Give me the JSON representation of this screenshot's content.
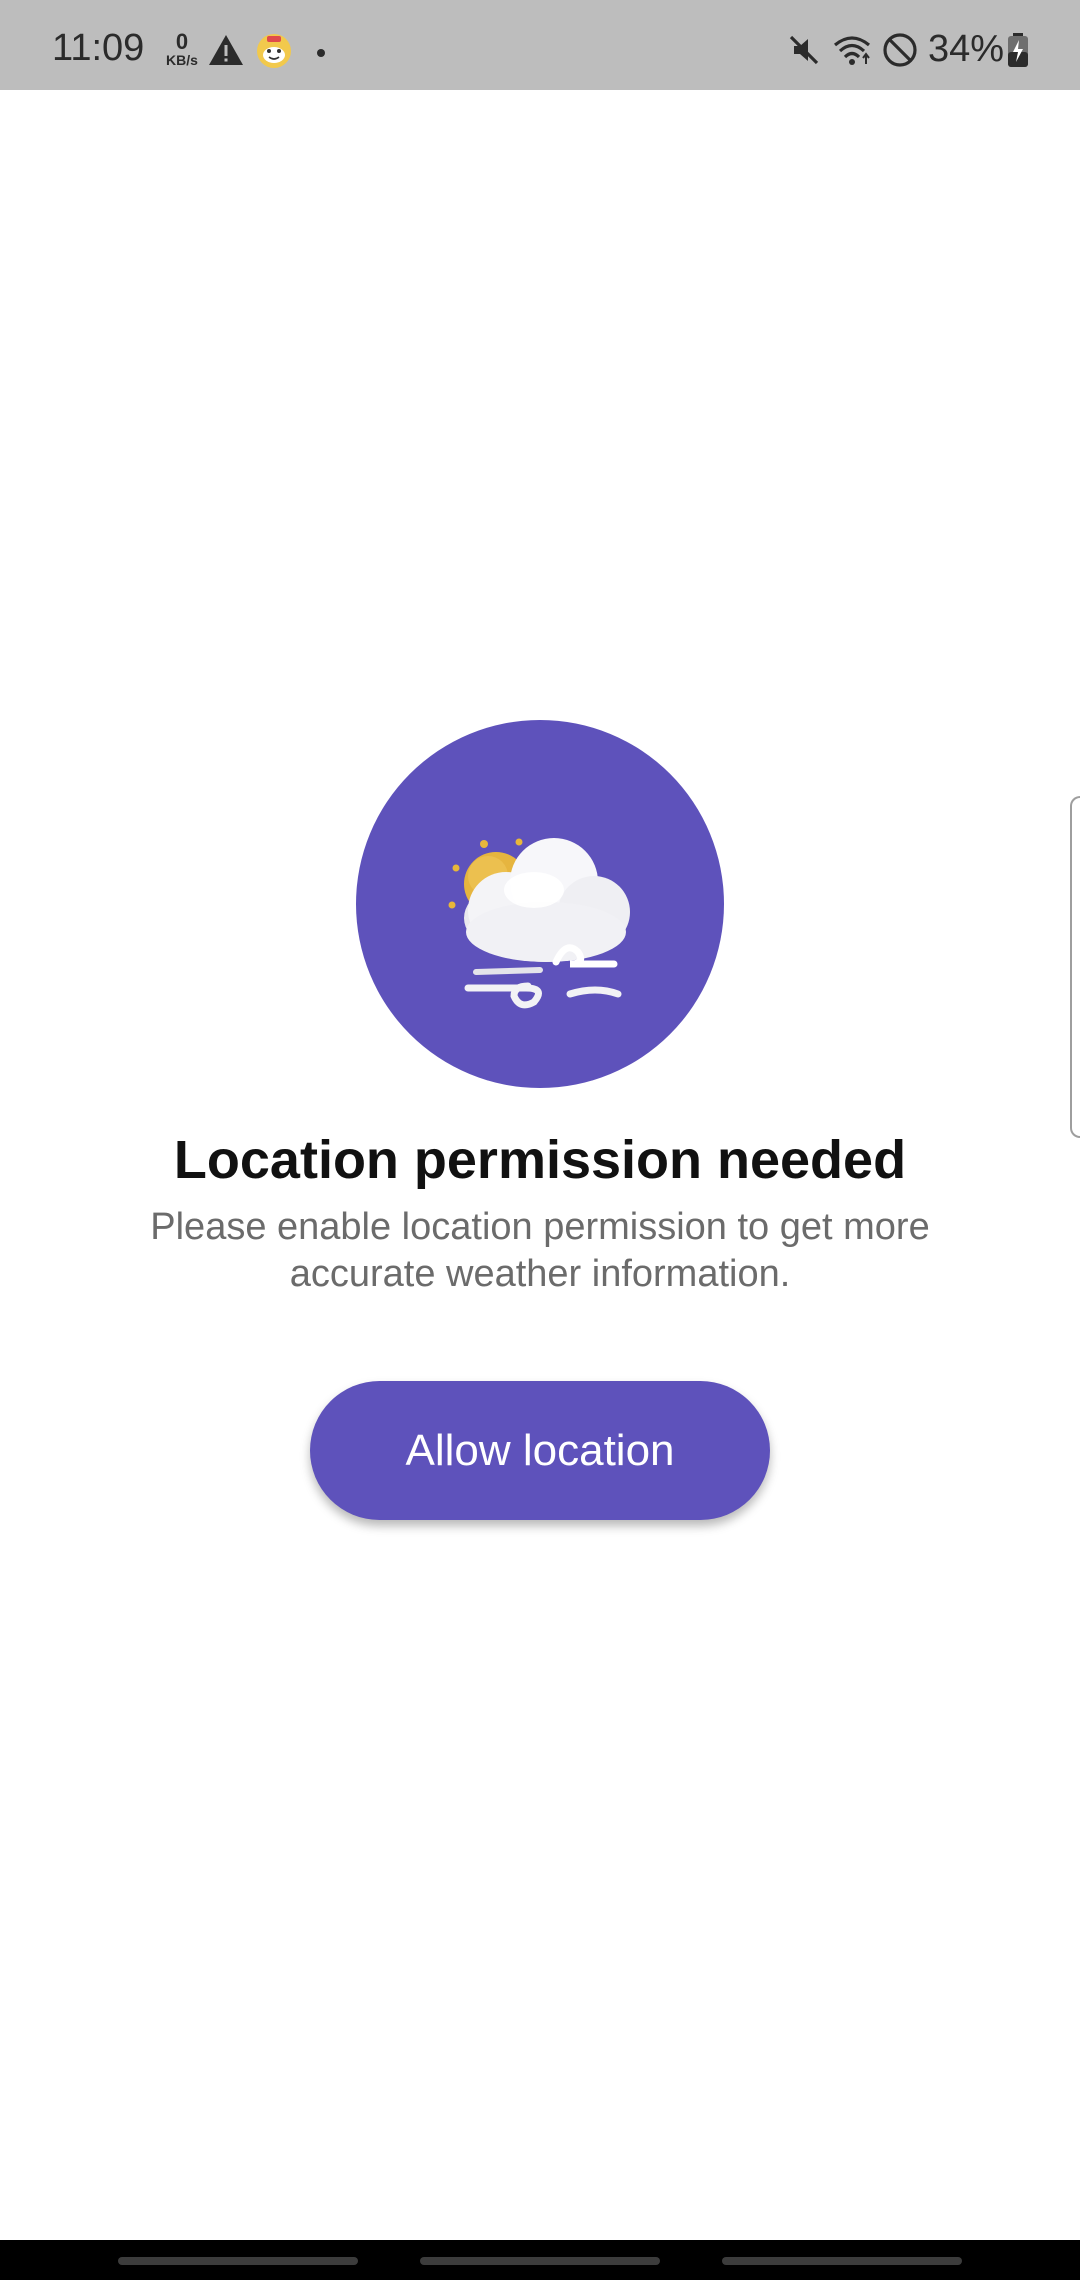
{
  "status_bar": {
    "time": "11:09",
    "net_speed_value": "0",
    "net_speed_unit": "KB/s",
    "battery_percent": "34%",
    "icons": [
      "warning-icon",
      "app-notification-icon",
      "dot-icon",
      "mute-icon",
      "wifi-icon",
      "do-not-disturb-icon",
      "battery-icon"
    ]
  },
  "main": {
    "illustration": "weather-cloud-sun-wind-icon",
    "title": "Location permission needed",
    "message": "Please enable location permission to get more accurate weather information.",
    "allow_button_label": "Allow location"
  },
  "colors": {
    "accent": "#5e52bb",
    "status_bar_bg": "#bdbdbd",
    "title_text": "#111111",
    "message_text": "#6b6b6b"
  }
}
